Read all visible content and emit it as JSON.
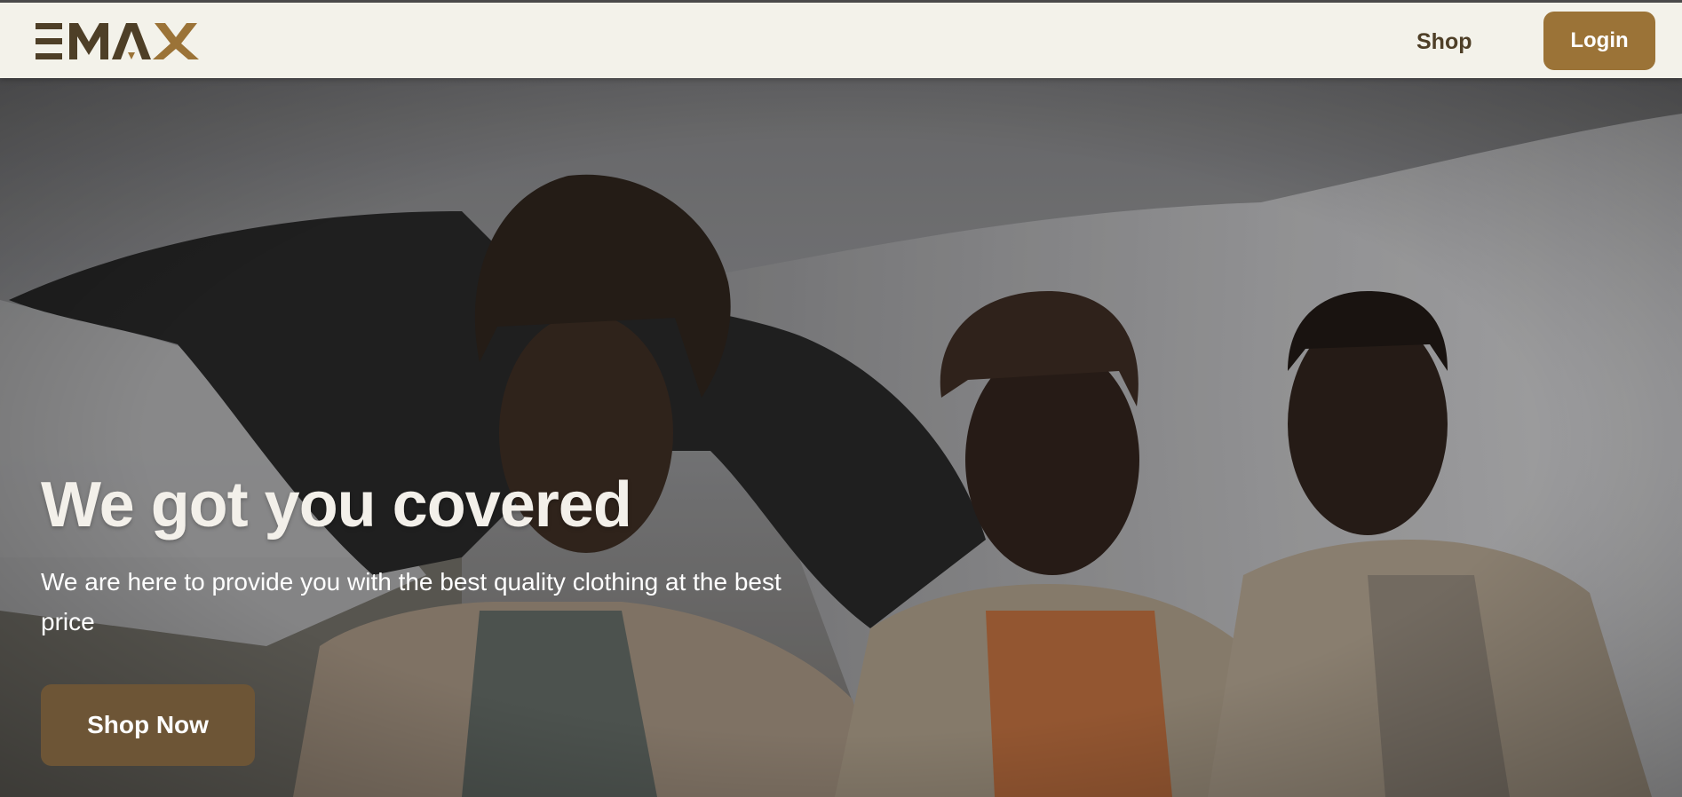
{
  "brand": {
    "name": "EMAX",
    "color_dark": "#4e3f27",
    "color_accent": "#9b7337"
  },
  "nav": {
    "shop_label": "Shop",
    "login_label": "Login"
  },
  "hero": {
    "title": "We got you covered",
    "subtitle": "We are here to provide you with the best quality clothing at the best price",
    "cta_label": "Shop Now",
    "image": "three-models-photo"
  },
  "colors": {
    "nav_background": "#f3f2ea",
    "login_button": "#9b7337",
    "cta_button": "#6d5536",
    "hero_text": "#ffffff"
  }
}
